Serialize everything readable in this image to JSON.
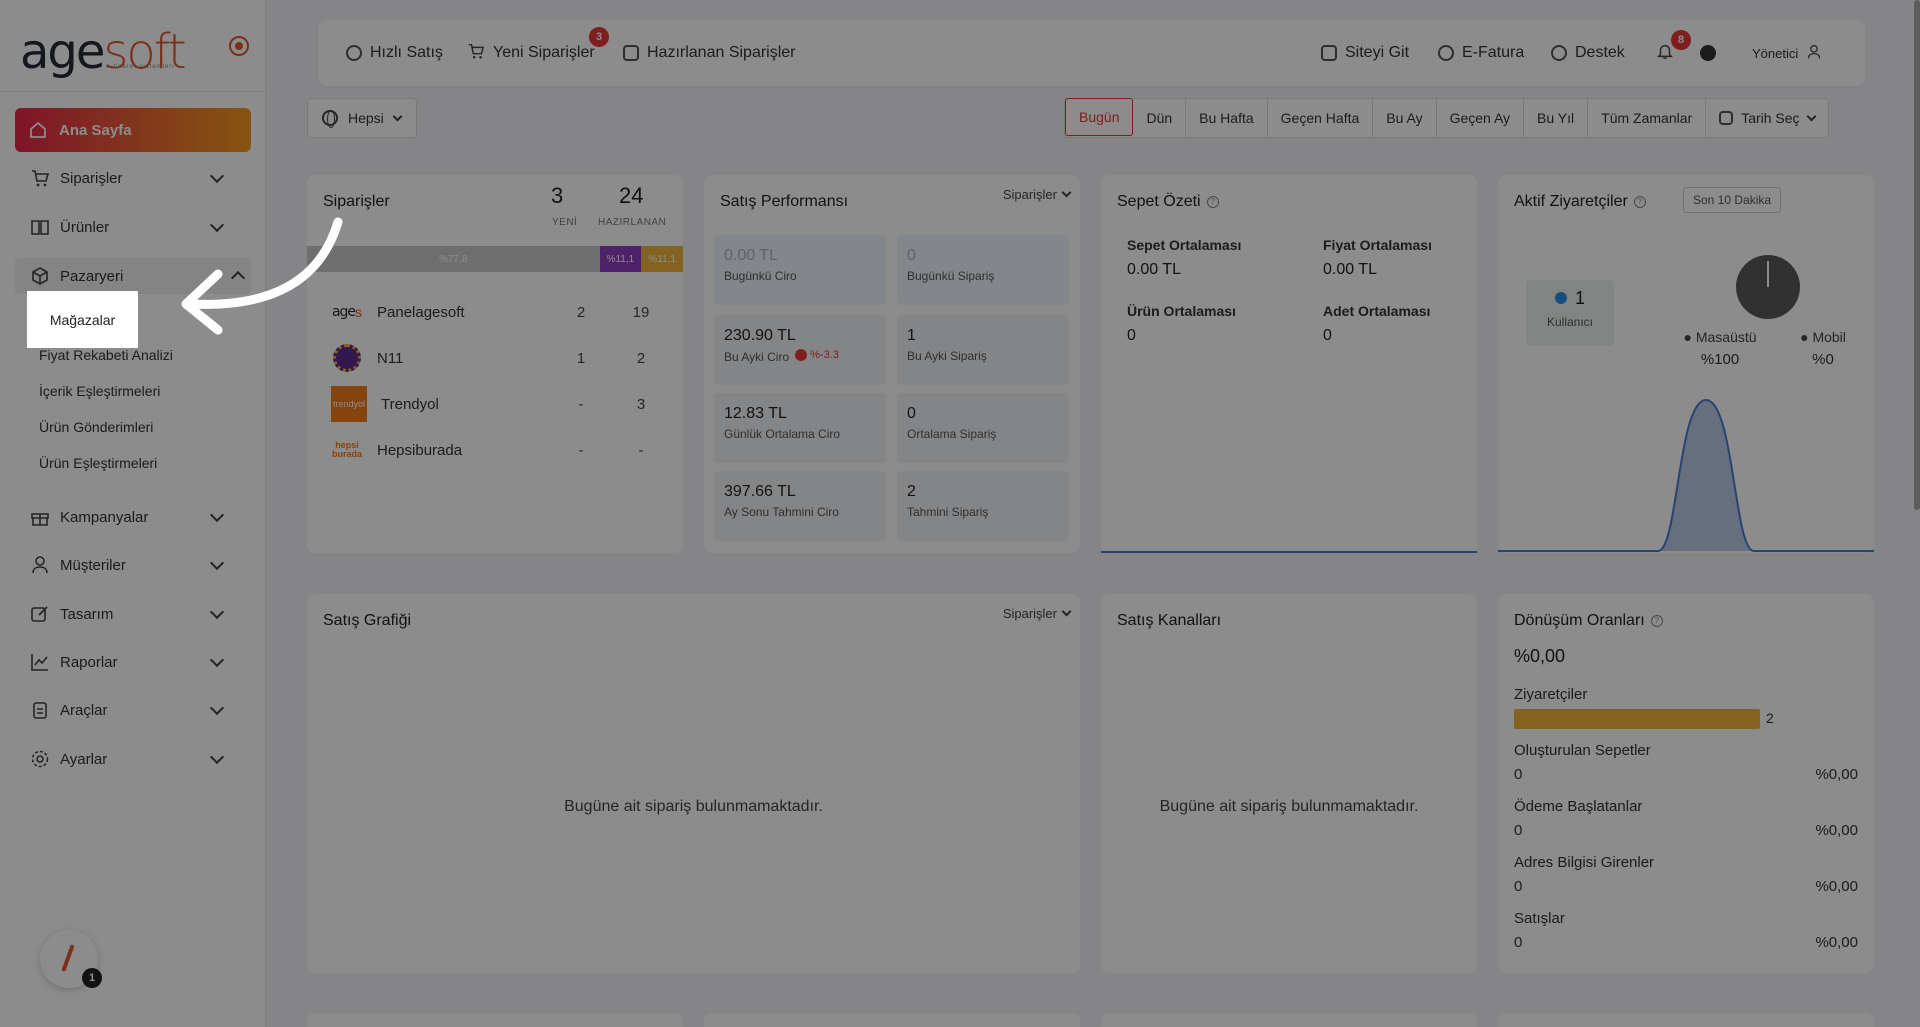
{
  "logo": {
    "brand_a": "age",
    "brand_b": "soft",
    "tagline": "e-ticaret sistemleri"
  },
  "sidebar": {
    "home": {
      "label": "Ana Sayfa",
      "icon": "home-icon"
    },
    "items": [
      {
        "label": "Siparişler",
        "icon": "cart-icon"
      },
      {
        "label": "Ürünler",
        "icon": "book-icon"
      },
      {
        "label": "Pazaryeri",
        "icon": "box-icon"
      },
      {
        "label": "Kampanyalar",
        "icon": "gift-icon"
      },
      {
        "label": "Müşteriler",
        "icon": "user-icon"
      },
      {
        "label": "Tasarım",
        "icon": "edit-icon"
      },
      {
        "label": "Raporlar",
        "icon": "chart-icon"
      },
      {
        "label": "Araçlar",
        "icon": "clipboard-icon"
      },
      {
        "label": "Ayarlar",
        "icon": "gear-icon"
      }
    ],
    "sub_items": [
      "Mağazalar",
      "Fiyat Rekabeti Analizi",
      "İçerik Eşleştirmeleri",
      "Ürün Gönderimleri",
      "Ürün Eşleştirmeleri"
    ],
    "corner_count": "1"
  },
  "topbar": {
    "quick_sale": "Hızlı Satış",
    "new_orders": "Yeni Siparişler",
    "new_orders_badge": "3",
    "prepared_orders": "Hazırlanan Siparişler",
    "go_site": "Siteyi Git",
    "einvoice": "E-Fatura",
    "support": "Destek",
    "notif_badge": "8",
    "user": "Yönetici"
  },
  "filter": {
    "scope": "Hepsi"
  },
  "date_range": [
    "Bugün",
    "Dün",
    "Bu Hafta",
    "Geçen Hafta",
    "Bu Ay",
    "Geçen Ay",
    "Bu Yıl",
    "Tüm Zamanlar",
    "Tarih Seç"
  ],
  "orders_card": {
    "title": "Siparişler",
    "new_count": "3",
    "new_label": "YENİ",
    "prep_count": "24",
    "prep_label": "HAZIRLANAN",
    "bar_labels": [
      "%77,8",
      "%11,1",
      "%11,1"
    ],
    "bar_share": [
      77.8,
      11.1,
      11.1
    ],
    "stores": [
      {
        "name": "Panelagesoft",
        "a": "2",
        "b": "19"
      },
      {
        "name": "N11",
        "a": "1",
        "b": "2"
      },
      {
        "name": "Trendyol",
        "a": "-",
        "b": "3"
      },
      {
        "name": "Hepsiburada",
        "a": "-",
        "b": "-"
      }
    ],
    "trendyol_logo": "trendyol",
    "hb_logo_a": "hepsi",
    "hb_logo_b": "burada"
  },
  "perf_card": {
    "title": "Satış Performansı",
    "dropdown": "Siparişler",
    "boxes": [
      {
        "value": "0.00 TL",
        "label": "Bugünkü Ciro"
      },
      {
        "value": "0",
        "label": "Bugünkü Sipariş"
      },
      {
        "value": "230.90 TL",
        "label": "Bu Ayki Ciro",
        "change": "%-3.3"
      },
      {
        "value": "1",
        "label": "Bu Ayki Sipariş"
      },
      {
        "value": "12.83 TL",
        "label": "Günlük Ortalama Ciro"
      },
      {
        "value": "0",
        "label": "Ortalama Sipariş"
      },
      {
        "value": "397.66 TL",
        "label": "Ay Sonu Tahmini Ciro"
      },
      {
        "value": "2",
        "label": "Tahmini Sipariş"
      }
    ]
  },
  "cart_card": {
    "title": "Sepet Özeti",
    "avg_cart_label": "Sepet Ortalaması",
    "avg_cart_value": "0.00 TL",
    "avg_price_label": "Fiyat Ortalaması",
    "avg_price_value": "0.00 TL",
    "avg_product_label": "Ürün Ortalaması",
    "avg_product_value": "0",
    "avg_qty_label": "Adet Ortalaması",
    "avg_qty_value": "0"
  },
  "visitors_card": {
    "title": "Aktif Ziyaretçiler",
    "range": "Son 10 Dakika",
    "users": "1",
    "users_label": "Kullanıcı",
    "desktop_label": "Masaüstü",
    "desktop_pct": "%100",
    "mobile_label": "Mobil",
    "mobile_pct": "%0"
  },
  "sales_chart_card": {
    "title": "Satış Grafiği",
    "dropdown": "Siparişler",
    "empty": "Bugüne ait sipariş bulunmamaktadır."
  },
  "channels_card": {
    "title": "Satış Kanalları",
    "empty": "Bugüne ait sipariş bulunmamaktadır."
  },
  "conversion_card": {
    "title": "Dönüşüm Oranları",
    "total": "%0,00",
    "visitors_label": "Ziyaretçiler",
    "visitors_count": "2",
    "rows": [
      {
        "label": "Oluşturulan Sepetler",
        "value": "0",
        "pct": "%0,00"
      },
      {
        "label": "Ödeme Başlatanlar",
        "value": "0",
        "pct": "%0,00"
      },
      {
        "label": "Adres Bilgisi Girenler",
        "value": "0",
        "pct": "%0,00"
      },
      {
        "label": "Satışlar",
        "value": "0",
        "pct": "%0,00"
      }
    ]
  },
  "colors": {
    "accent": "#e53935",
    "brand_orange": "#f39c1f",
    "bar_gold": "#f1b43c",
    "bar_purple": "#8e3fbf"
  }
}
